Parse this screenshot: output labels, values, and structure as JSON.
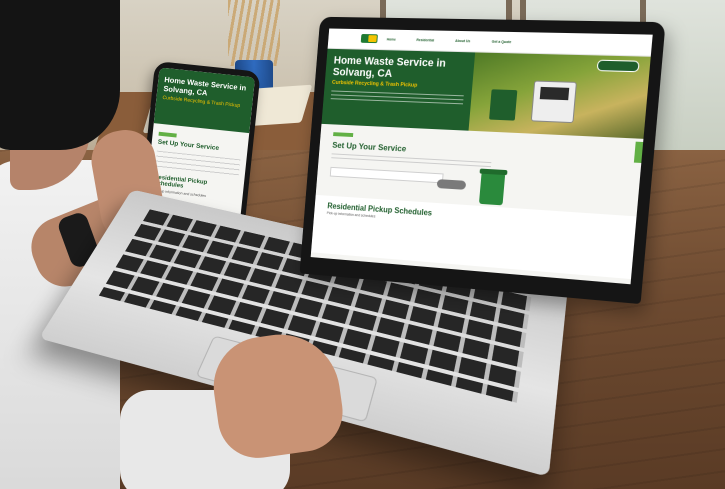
{
  "laptop_site": {
    "nav": [
      "Home",
      "Residential",
      "About Us",
      "",
      "Get a Quote"
    ],
    "hero": {
      "title": "Home Waste Service in Solvang, CA",
      "subtitle": "Curbside Recycling & Trash Pickup",
      "button": ""
    },
    "setup_section": {
      "title": "Set Up Your Service"
    },
    "schedule_section": {
      "title": "Residential Pickup Schedules",
      "small_text": "Pick-up information and schedules"
    }
  },
  "phone_site": {
    "hero": {
      "title": "Home Waste Service in Solvang, CA",
      "subtitle": "Curbside Recycling & Trash Pickup"
    },
    "setup_title": "Set Up Your Service",
    "schedule_title": "Residential Pickup Schedules",
    "schedule_small": "Pick-up information and schedules"
  },
  "colors": {
    "brand_green": "#1f5e2c",
    "accent_yellow": "#f2c400",
    "accent_light_green": "#62b045"
  }
}
